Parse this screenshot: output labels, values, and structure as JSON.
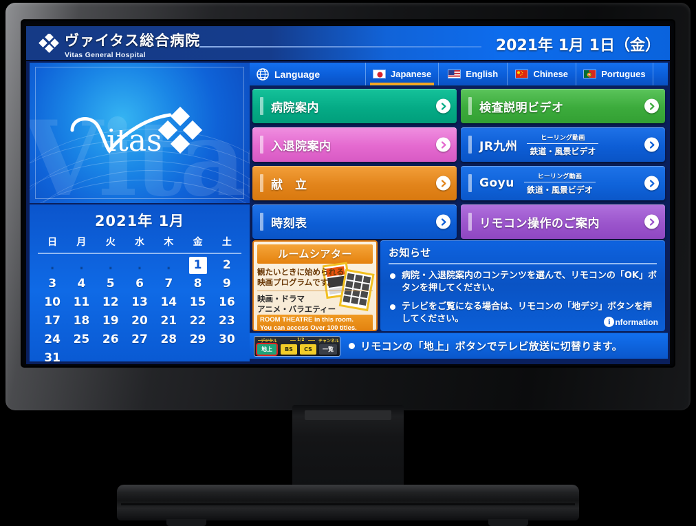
{
  "header": {
    "logo_icon": "diamond-cluster-logo",
    "hospital_name_jp": "ヴァイタス総合病院",
    "hospital_name_en": "Vitas General Hospital",
    "date": "2021年 1月 1日（金）"
  },
  "logo_panel": {
    "brand": "Vitas",
    "ghost_text": "Vitas",
    "mark_icon": "four-diamond-mark"
  },
  "calendar": {
    "title": "2021年 1月",
    "weekdays": [
      "日",
      "月",
      "火",
      "水",
      "木",
      "金",
      "土"
    ],
    "leading_blanks": 5,
    "days": [
      1,
      2,
      3,
      4,
      5,
      6,
      7,
      8,
      9,
      10,
      11,
      12,
      13,
      14,
      15,
      16,
      17,
      18,
      19,
      20,
      21,
      22,
      23,
      24,
      25,
      26,
      27,
      28,
      29,
      30,
      31
    ],
    "today": 1
  },
  "language_bar": {
    "globe_icon": "globe-icon",
    "label": "Language",
    "options": [
      {
        "name": "Japanese",
        "flag": "flag-japan",
        "active": true
      },
      {
        "name": "English",
        "flag": "flag-usa",
        "active": false
      },
      {
        "name": "Chinese",
        "flag": "flag-china",
        "active": false
      },
      {
        "name": "Portugues",
        "flag": "flag-portugal",
        "active": false
      }
    ]
  },
  "menu": {
    "arrow_icon": "chevron-right-icon",
    "items": [
      {
        "label": "病院案内",
        "color": "#05ab86",
        "sub1": "",
        "sub2": ""
      },
      {
        "label": "検査説明ビデオ",
        "color": "#3cab3c",
        "sub1": "",
        "sub2": ""
      },
      {
        "label": "入退院案内",
        "color": "#e469cf",
        "sub1": "",
        "sub2": ""
      },
      {
        "label": "JR九州",
        "color": "#0d5ed6",
        "sub1": "ヒーリング動画",
        "sub2": "鉄道・風景ビデオ"
      },
      {
        "label": "献　立",
        "color": "#e2841b",
        "sub1": "",
        "sub2": ""
      },
      {
        "label": "Goyu",
        "color": "#0f63da",
        "sub1": "ヒーリング動画",
        "sub2": "鉄道・風景ビデオ"
      },
      {
        "label": "時刻表",
        "color": "#0d5ed6",
        "sub1": "",
        "sub2": ""
      },
      {
        "label": "リモコン操作のご案内",
        "color": "#9b55cc",
        "sub1": "",
        "sub2": ""
      }
    ]
  },
  "theatre": {
    "title": "ルームシアター",
    "desc_line1": "観たいときに始められる",
    "desc_line2": "映画プログラムです。",
    "genres_line1": "映画・ドラマ",
    "genres_line2": "アニメ・バラエティー",
    "en_line1": "ROOM THEATRE in this room.",
    "en_line2": "You can access Over 100 titles.",
    "art_icon": "movie-catalog-thumbnails"
  },
  "notice": {
    "title": "お知らせ",
    "items": [
      "病院・入退院案内のコンテンツを選んで、リモコンの「OK」ボタンを押してください。",
      "テレビをご覧になる場合は、リモコンの「地デジ」ボタンを押してください。"
    ],
    "badge_icon": "information-icon",
    "badge_i": "i",
    "badge_text": "nformation"
  },
  "status_bar": {
    "remote": {
      "caption_digital": "デジタル",
      "caption_half": "1/2",
      "caption_channel": "チャンネル",
      "buttons": [
        "地上",
        "BS",
        "CS",
        "一覧"
      ]
    },
    "message": "リモコンの「地上」ボタンでテレビ放送に切替ります。"
  }
}
